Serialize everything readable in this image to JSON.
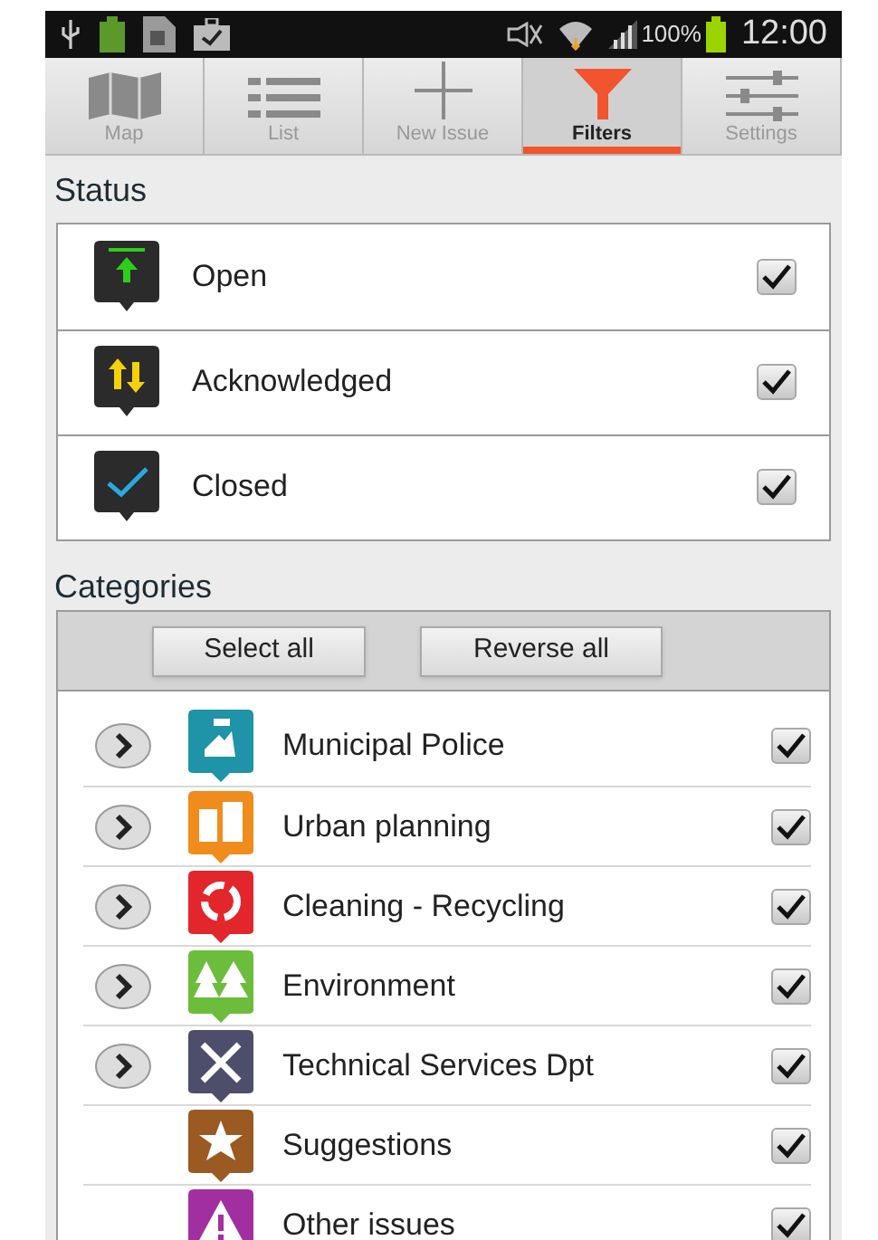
{
  "status_bar": {
    "battery_percent": "100%",
    "time": "12:00"
  },
  "tabs": [
    {
      "label": "Map",
      "selected": false
    },
    {
      "label": "List",
      "selected": false
    },
    {
      "label": "New Issue",
      "selected": false
    },
    {
      "label": "Filters",
      "selected": true
    },
    {
      "label": "Settings",
      "selected": false
    }
  ],
  "status": {
    "title": "Status",
    "items": [
      {
        "label": "Open",
        "checked": true
      },
      {
        "label": "Acknowledged",
        "checked": true
      },
      {
        "label": "Closed",
        "checked": true
      }
    ]
  },
  "categories": {
    "title": "Categories",
    "buttons": [
      "Select all",
      "Reverse all"
    ],
    "items": [
      {
        "label": "Municipal Police",
        "expandable": true,
        "color": "#1f93a8",
        "checked": true
      },
      {
        "label": "Urban planning",
        "expandable": true,
        "color": "#f08c1c",
        "checked": true
      },
      {
        "label": "Cleaning - Recycling",
        "expandable": true,
        "color": "#e3262b",
        "checked": true
      },
      {
        "label": "Environment",
        "expandable": true,
        "color": "#6cbd3c",
        "checked": true
      },
      {
        "label": "Technical Services Dpt",
        "expandable": true,
        "color": "#4d4e6b",
        "checked": true
      },
      {
        "label": "Suggestions",
        "expandable": false,
        "color": "#9a5a22",
        "checked": true
      },
      {
        "label": "Other issues",
        "expandable": false,
        "color": "#a22fa0",
        "checked": true
      }
    ]
  }
}
